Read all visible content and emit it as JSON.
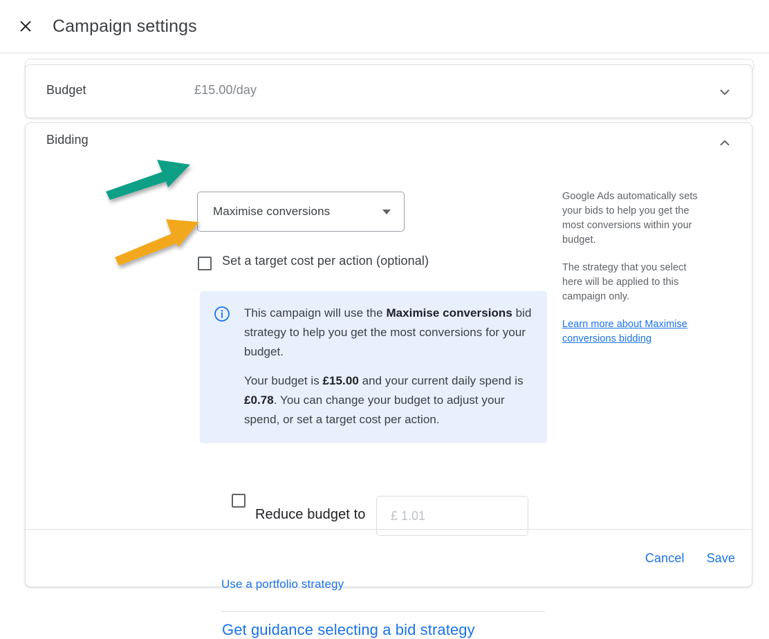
{
  "header": {
    "title": "Campaign settings",
    "close_icon": "close-icon"
  },
  "budget_card": {
    "label": "Budget",
    "value": "£15.00/day",
    "toggle_icon": "chevron-down-icon"
  },
  "bidding_card": {
    "label": "Bidding",
    "toggle_icon": "chevron-up-icon",
    "strategy_select": {
      "value": "Maximise conversions",
      "dropdown_icon": "chevron-down-icon"
    },
    "target_cpa_checkbox": {
      "label": "Set a target cost per action (optional)",
      "checked": false
    },
    "info_box": {
      "icon": "info-circle-icon",
      "paragraph1_prefix": "This campaign will use the ",
      "paragraph1_bold": "Maximise conversions",
      "paragraph1_suffix": " bid strategy to help you get the most conversions for your budget.",
      "paragraph2_prefix": "Your budget is ",
      "paragraph2_bold1": "£15.00",
      "paragraph2_mid": " and your current daily spend is ",
      "paragraph2_bold2": "£0.78",
      "paragraph2_suffix": ". You can change your budget to adjust your spend, or set a target cost per action."
    },
    "reduce_budget": {
      "checked": false,
      "label": "Reduce budget to",
      "input_value": "",
      "input_placeholder": "£ 1.01"
    },
    "portfolio_link": "Use a portfolio strategy",
    "guidance_link": "Get guidance selecting a bid strategy"
  },
  "help_panel": {
    "paragraph1": "Google Ads automatically sets your bids to help you get the most conversions within your budget.",
    "paragraph2": "The strategy that you select here will be applied to this campaign only.",
    "link": "Learn more about Maximise conversions bidding"
  },
  "footer": {
    "cancel_label": "Cancel",
    "save_label": "Save"
  },
  "annotations": [
    {
      "name": "teal-arrow",
      "color": "#0da087",
      "points_to": "strategy-select"
    },
    {
      "name": "orange-arrow",
      "color": "#f2a81d",
      "points_to": "target-cpa-checkbox"
    }
  ],
  "colors": {
    "accent_blue": "#1a73e8",
    "info_bg": "#e8f0fe",
    "text_primary": "#3c4043",
    "text_secondary": "#5f6368",
    "teal": "#0da087",
    "orange": "#f2a81d"
  }
}
